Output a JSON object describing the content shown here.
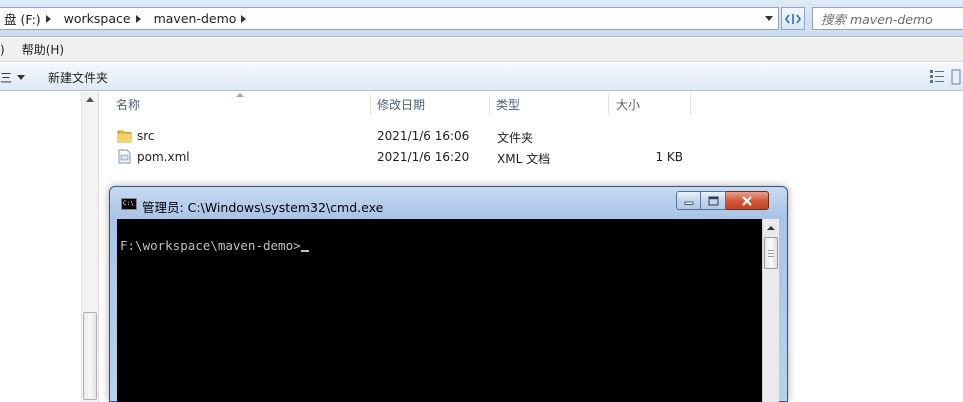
{
  "address_bar": {
    "breadcrumbs": [
      "盘 (F:)",
      "workspace",
      "maven-demo"
    ],
    "search_placeholder": "搜索 maven-demo"
  },
  "menu": {
    "items": [
      ")",
      "帮助(H)"
    ]
  },
  "command_bar": {
    "organize_label": "三",
    "new_folder_label": "新建文件夹"
  },
  "file_list": {
    "columns": [
      "名称",
      "修改日期",
      "类型",
      "大小"
    ],
    "rows": [
      {
        "name": "src",
        "modified": "2021/1/6 16:06",
        "type": "文件夹",
        "size": "",
        "icon": "folder-icon"
      },
      {
        "name": "pom.xml",
        "modified": "2021/1/6 16:20",
        "type": "XML 文档",
        "size": "1 KB",
        "icon": "xml-file-icon"
      }
    ]
  },
  "cmd_window": {
    "title": "管理员: C:\\Windows\\system32\\cmd.exe",
    "icon_text": "C:\\",
    "prompt": "F:\\workspace\\maven-demo>"
  },
  "colors": {
    "console_bg": "#000000",
    "console_fg": "#c0c0c0",
    "titlebar": "#b9d1ee",
    "close_button": "#c94a2e"
  }
}
